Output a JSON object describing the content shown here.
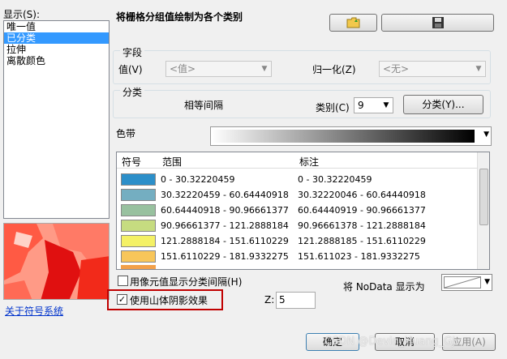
{
  "left": {
    "header": "显示(S):",
    "items": [
      "唯一值",
      "已分类",
      "拉伸",
      "离散颜色"
    ],
    "selected_index": 1,
    "link": "关于符号系统"
  },
  "title": "将栅格分组值绘制为各个类别",
  "field_group": {
    "title": "字段",
    "value_label": "值(V)",
    "value_combo": "<值>",
    "normalize_label": "归一化(Z)",
    "normalize_combo": "<无>"
  },
  "class_group": {
    "title": "分类",
    "method": "相等间隔",
    "classes_label": "类别(C)",
    "classes_value": "9",
    "classify_button": "分类(Y)..."
  },
  "color_ramp_label": "色带",
  "table": {
    "headers": [
      "符号",
      "范围",
      "标注"
    ],
    "rows": [
      {
        "color": "#2c8fc9",
        "range": "0 - 30.32220459",
        "label": "0 - 30.32220459"
      },
      {
        "color": "#74aec1",
        "range": "30.32220459 - 60.64440918",
        "label": "30.32220046 - 60.64440918"
      },
      {
        "color": "#98c19f",
        "range": "60.64440918 - 90.96661377",
        "label": "60.64440919 - 90.96661377"
      },
      {
        "color": "#c6dc80",
        "range": "90.96661377 - 121.2888184",
        "label": "90.96661378 - 121.2888184"
      },
      {
        "color": "#f4f165",
        "range": "121.2888184 - 151.6110229",
        "label": "121.2888185 - 151.6110229"
      },
      {
        "color": "#f8c65a",
        "range": "151.6110229 - 181.9332275",
        "label": "151.611023 - 181.9332275"
      }
    ]
  },
  "options": {
    "hillshade_separators_label": "用像元值显示分类间隔(H)",
    "hillshade_label": "使用山体阴影效果",
    "hillshade_checked": true,
    "z_label": "Z:",
    "z_value": "5",
    "nodata_label": "将 NoData 显示为"
  },
  "footer": {
    "ok": "确定",
    "cancel": "取消",
    "apply": "应用(A)",
    "watermark": "CSDN @Devin_Huang_GJ"
  }
}
